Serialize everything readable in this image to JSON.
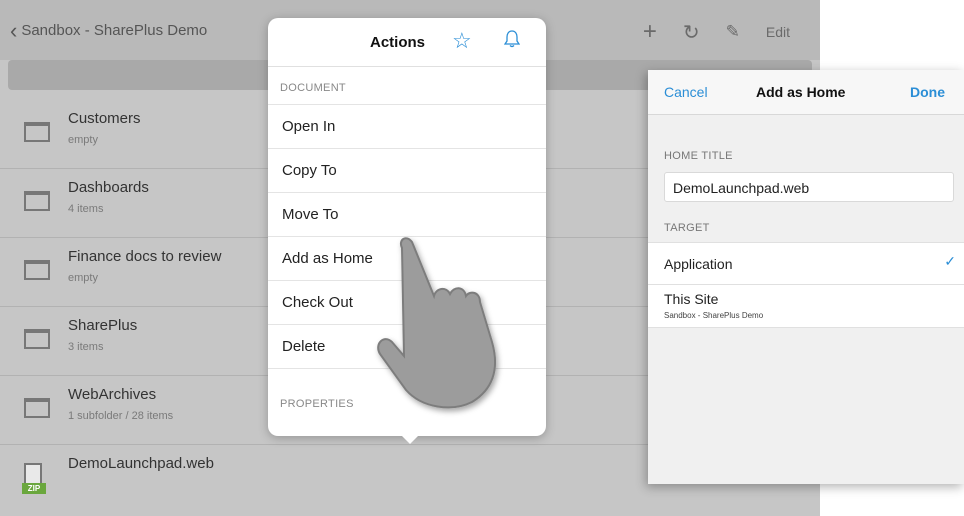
{
  "nav": {
    "back_label": "Sandbox - SharePlus Demo",
    "plus_icon": "+",
    "refresh_icon": "↻",
    "settings_icon": "✎",
    "edit_label": "Edit"
  },
  "list": [
    {
      "title": "Customers",
      "sub": "empty",
      "icon": "folder-icon"
    },
    {
      "title": "Dashboards",
      "sub": "4 items",
      "icon": "folder-icon"
    },
    {
      "title": "Finance docs to review",
      "sub": "empty",
      "icon": "folder-icon"
    },
    {
      "title": "SharePlus",
      "sub": "3 items",
      "icon": "folder-icon"
    },
    {
      "title": "WebArchives",
      "sub": "1 subfolder / 28 items",
      "icon": "folder-icon"
    },
    {
      "title": "DemoLaunchpad.web",
      "sub": "",
      "icon": "zip-file-icon",
      "badge": "ZIP"
    }
  ],
  "actions": {
    "title": "Actions",
    "star_icon": "☆",
    "document_section": "DOCUMENT",
    "items": [
      "Open In",
      "Copy To",
      "Move To",
      "Add as Home",
      "Check Out",
      "Delete"
    ],
    "properties_section": "PROPERTIES"
  },
  "add_home": {
    "cancel": "Cancel",
    "title": "Add as Home",
    "done": "Done",
    "home_title_section": "HOME TITLE",
    "home_title_value": "DemoLaunchpad.web",
    "target_section": "TARGET",
    "application_label": "Application",
    "check_icon": "✓",
    "this_site_label": "This Site",
    "this_site_sub": "Sandbox - SharePlus Demo"
  },
  "colors": {
    "accent": "#2b8ed6",
    "zip_badge": "#6aa73d"
  }
}
